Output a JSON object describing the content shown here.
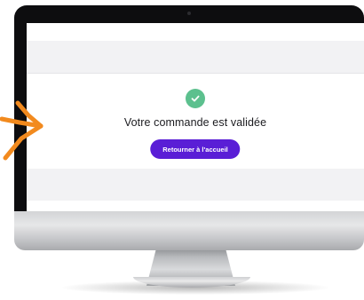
{
  "screen": {
    "confirmation_message": "Votre commande est validée",
    "home_button_label": "Retourner à l'accueil"
  },
  "icons": {
    "status": "check-circle-icon",
    "pointer": "arrow-icon"
  },
  "colors": {
    "success_green": "#5cc08e",
    "button_purple": "#5a1ed6",
    "arrow_orange": "#f28a1e",
    "band_gray": "#f2f2f4"
  }
}
